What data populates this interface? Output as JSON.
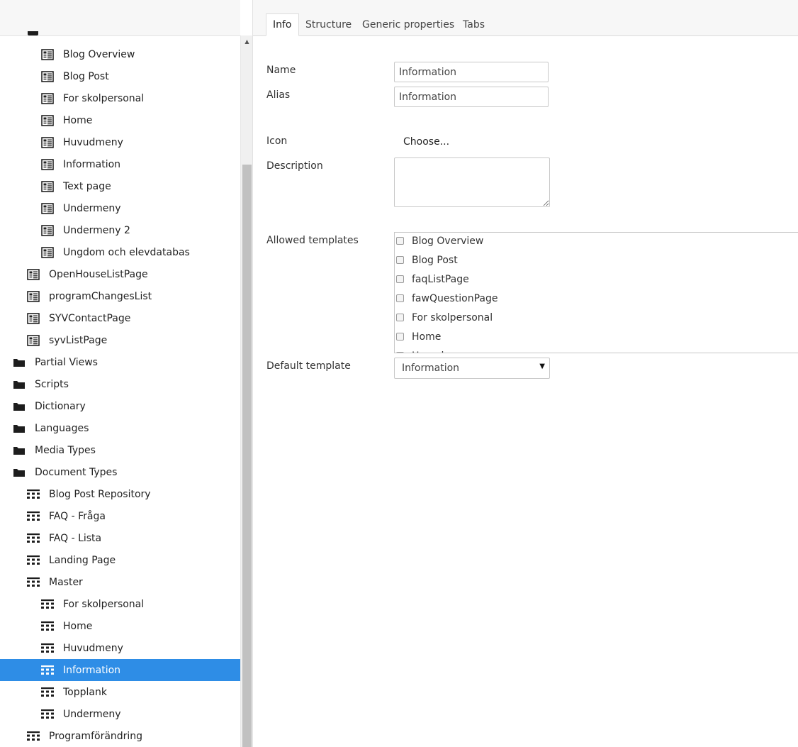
{
  "tree": {
    "items": [
      {
        "label": "Blog Overview",
        "icon": "template-icon",
        "depth": 2
      },
      {
        "label": "Blog Post",
        "icon": "template-icon",
        "depth": 2
      },
      {
        "label": "For skolpersonal",
        "icon": "template-icon",
        "depth": 2
      },
      {
        "label": "Home",
        "icon": "template-icon",
        "depth": 2
      },
      {
        "label": "Huvudmeny",
        "icon": "template-icon",
        "depth": 2
      },
      {
        "label": "Information",
        "icon": "template-icon",
        "depth": 2
      },
      {
        "label": "Text page",
        "icon": "template-icon",
        "depth": 2
      },
      {
        "label": "Undermeny",
        "icon": "template-icon",
        "depth": 2
      },
      {
        "label": "Undermeny 2",
        "icon": "template-icon",
        "depth": 2
      },
      {
        "label": "Ungdom och elevdatabas",
        "icon": "template-icon",
        "depth": 2
      },
      {
        "label": "OpenHouseListPage",
        "icon": "template-icon",
        "depth": 1
      },
      {
        "label": "programChangesList",
        "icon": "template-icon",
        "depth": 1
      },
      {
        "label": "SYVContactPage",
        "icon": "template-icon",
        "depth": 1
      },
      {
        "label": "syvListPage",
        "icon": "template-icon",
        "depth": 1
      },
      {
        "label": "Partial Views",
        "icon": "folder-icon",
        "depth": 0
      },
      {
        "label": "Scripts",
        "icon": "folder-icon",
        "depth": 0
      },
      {
        "label": "Dictionary",
        "icon": "folder-icon",
        "depth": 0
      },
      {
        "label": "Languages",
        "icon": "folder-icon",
        "depth": 0
      },
      {
        "label": "Media Types",
        "icon": "folder-icon",
        "depth": 0
      },
      {
        "label": "Document Types",
        "icon": "folder-icon",
        "depth": 0
      },
      {
        "label": "Blog Post Repository",
        "icon": "document-type-icon",
        "depth": 1
      },
      {
        "label": "FAQ - Fråga",
        "icon": "document-type-icon",
        "depth": 1
      },
      {
        "label": "FAQ - Lista",
        "icon": "document-type-icon",
        "depth": 1
      },
      {
        "label": "Landing Page",
        "icon": "document-type-icon",
        "depth": 1
      },
      {
        "label": "Master",
        "icon": "document-type-icon",
        "depth": 1
      },
      {
        "label": "For skolpersonal",
        "icon": "document-type-icon",
        "depth": 2
      },
      {
        "label": "Home",
        "icon": "document-type-icon",
        "depth": 2
      },
      {
        "label": "Huvudmeny",
        "icon": "document-type-icon",
        "depth": 2
      },
      {
        "label": "Information",
        "icon": "document-type-icon",
        "depth": 2,
        "selected": true
      },
      {
        "label": "Topplank",
        "icon": "document-type-icon",
        "depth": 2
      },
      {
        "label": "Undermeny",
        "icon": "document-type-icon",
        "depth": 2
      },
      {
        "label": "Programförändring",
        "icon": "document-type-icon",
        "depth": 1
      }
    ],
    "selected_color": "#2e8de6"
  },
  "tabs": [
    {
      "label": "Info",
      "active": true
    },
    {
      "label": "Structure"
    },
    {
      "label": "Generic properties"
    },
    {
      "label": "Tabs"
    }
  ],
  "form": {
    "name_label": "Name",
    "name_value": "Information",
    "alias_label": "Alias",
    "alias_value": "Information",
    "icon_label": "Icon",
    "icon_choose": "Choose...",
    "description_label": "Description",
    "description_value": "",
    "allowed_templates_label": "Allowed templates",
    "allowed_templates": [
      {
        "label": "Blog Overview",
        "checked": false
      },
      {
        "label": "Blog Post",
        "checked": false
      },
      {
        "label": "faqListPage",
        "checked": false
      },
      {
        "label": "fawQuestionPage",
        "checked": false
      },
      {
        "label": "For skolpersonal",
        "checked": false
      },
      {
        "label": "Home",
        "checked": false
      },
      {
        "label": "Huvudmeny",
        "checked": false
      }
    ],
    "default_template_label": "Default template",
    "default_template_value": "Information"
  }
}
